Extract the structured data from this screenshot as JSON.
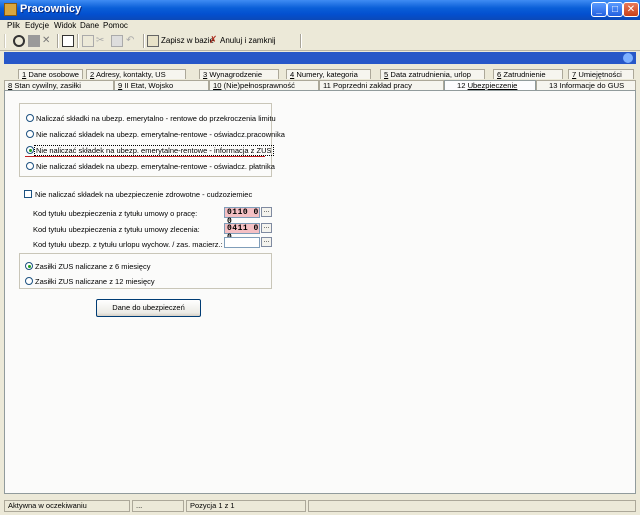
{
  "window": {
    "title": "Pracownicy",
    "minimize": "_",
    "maximize": "□",
    "close": "✕"
  },
  "menu": [
    "Plik",
    "Edycje",
    "Widok",
    "Dane",
    "Pomoc"
  ],
  "toolbar": {
    "save_label": "Zapisz w bazie",
    "cancel_label": "Anuluj i zamknij"
  },
  "tabs_row1": [
    {
      "num": "1",
      "label": "Dane osobowe"
    },
    {
      "num": "2",
      "label": "Adresy, kontakty, US"
    },
    {
      "num": "3",
      "label": "Wynagrodzenie"
    },
    {
      "num": "4",
      "label": "Numery, kategoria"
    },
    {
      "num": "5",
      "label": "Data zatrudnienia, urlop"
    },
    {
      "num": "6",
      "label": "Zatrudnienie"
    },
    {
      "num": "7",
      "label": "Umiejętności"
    }
  ],
  "tabs_row2": [
    {
      "num": "8",
      "label": "Stan cywilny, zasiłki"
    },
    {
      "num": "9",
      "label": "II Etat, Wojsko"
    },
    {
      "num": "10",
      "label": "(Nie)pełnosprawność"
    },
    {
      "num": "11",
      "label": "Poprzedni zakład pracy"
    },
    {
      "num": "12",
      "label": "Ubezpieczenie"
    },
    {
      "num": "13",
      "label": "Informacje do GUS"
    }
  ],
  "pension_options": [
    "Naliczać składki na ubezp. emerytalno - rentowe do przekroczenia limitu",
    "Nie naliczać składek na ubezp. emerytalne-rentowe - oświadcz.pracownika",
    "Nie naliczać składek na ubezp. emerytalne-rentowe - informacja z ZUS",
    "Nie naliczać składek na ubezp. emerytalne-rentowe - oświadcz. płatnika"
  ],
  "pension_selected": 2,
  "health_checkbox_label": "Nie naliczać składek na ubezpieczenie zdrowotne - cudzoziemiec",
  "codes": [
    {
      "label": "Kod tytułu ubezpieczenia  z tytułu umowy o pracę:",
      "value": "0110 0 0"
    },
    {
      "label": "Kod tytułu ubezpieczenia  z tytułu umowy zlecenia:",
      "value": "0411 0 0"
    },
    {
      "label": "Kod tytułu ubezp.  z tytułu urlopu wychow. / zas. macierz.:",
      "value": ""
    }
  ],
  "dots_label": "...",
  "zus_options": [
    "Zasiłki ZUS naliczane z 6 miesięcy",
    "Zasiłki ZUS naliczane z 12 miesięcy"
  ],
  "zus_selected": 0,
  "insurance_button": "Dane do ubezpieczeń",
  "status": {
    "left": "Aktywna w oczekiwaniu",
    "mid": "...",
    "pos": "Pozycja 1 z 1"
  }
}
